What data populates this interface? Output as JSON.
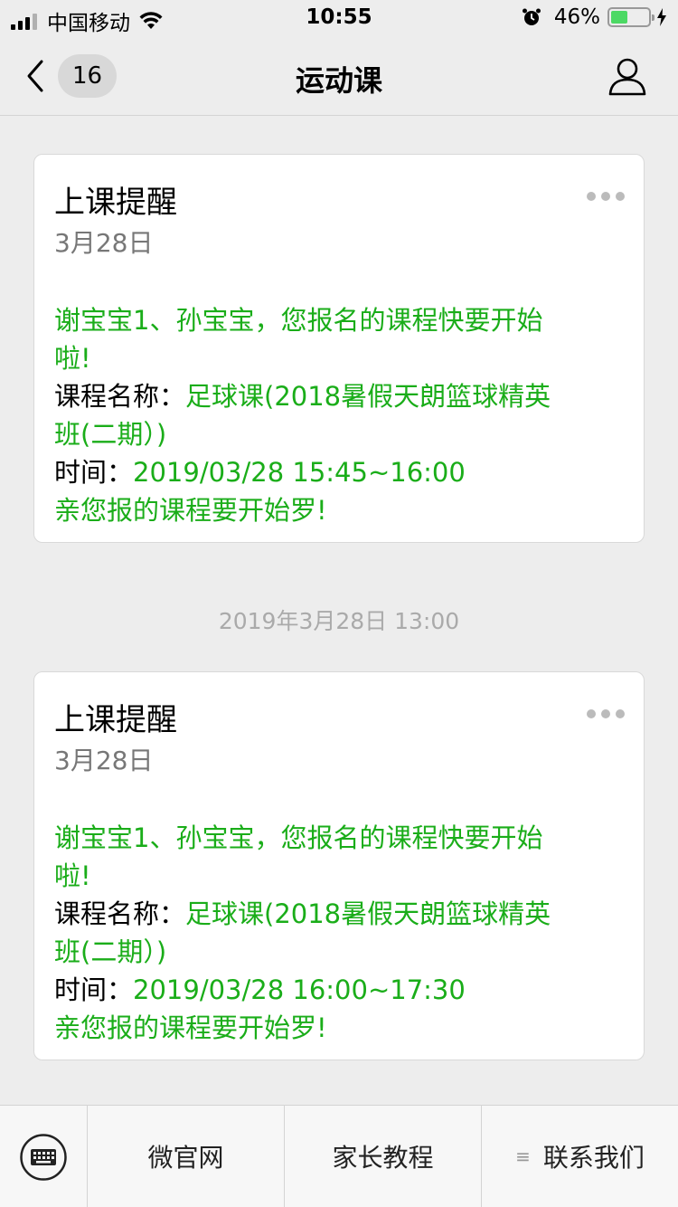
{
  "status_bar": {
    "carrier": "中国移动",
    "time": "10:55",
    "battery_percent": "46%",
    "battery_level": 0.46
  },
  "nav": {
    "unread_count": "16",
    "title": "运动课"
  },
  "cards": [
    {
      "title": "上课提醒",
      "date": "3月28日",
      "greeting_line1": "谢宝宝1、孙宝宝，您报名的课程快要开始",
      "greeting_line2": "啦!",
      "course_label": "课程名称：",
      "course_value_line1": "足球课(2018暑假天朗篮球精英",
      "course_value_line2": "班(二期）)",
      "time_label": "时间：",
      "time_value": "2019/03/28 15:45~16:00",
      "closing": "亲您报的课程要开始罗!"
    },
    {
      "title": "上课提醒",
      "date": "3月28日",
      "greeting_line1": "谢宝宝1、孙宝宝，您报名的课程快要开始",
      "greeting_line2": "啦!",
      "course_label": "课程名称：",
      "course_value_line1": "足球课(2018暑假天朗篮球精英",
      "course_value_line2": "班(二期）)",
      "time_label": "时间：",
      "time_value": "2019/03/28 16:00~17:30",
      "closing": "亲您报的课程要开始罗!"
    }
  ],
  "timestamp": "2019年3月28日 13:00",
  "bottom_menu": {
    "items": [
      {
        "label": "微官网"
      },
      {
        "label": "家长教程"
      },
      {
        "label": "联系我们",
        "icon": "submenu-lines-icon"
      }
    ]
  },
  "colors": {
    "accent_green": "#1aad19",
    "background": "#ededed",
    "battery_green": "#4cd964"
  }
}
